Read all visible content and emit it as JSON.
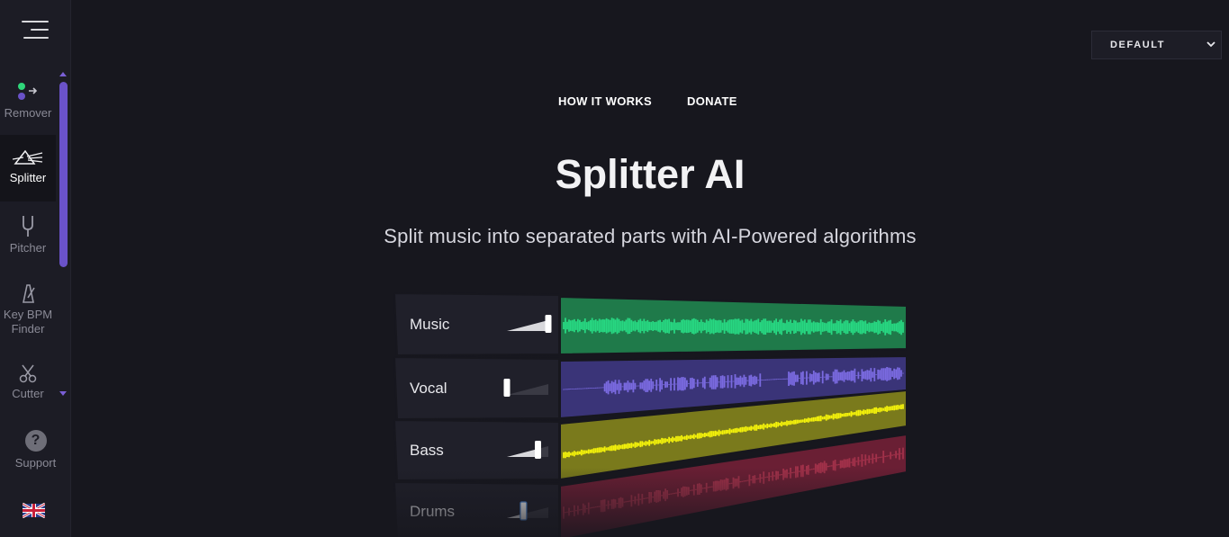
{
  "sidebar": {
    "items": [
      {
        "label": "Remover",
        "icon": "remover-icon"
      },
      {
        "label": "Splitter",
        "icon": "prism-icon",
        "active": true
      },
      {
        "label": "Pitcher",
        "icon": "tuning-fork-icon"
      },
      {
        "label": "Key BPM\nFinder",
        "icon": "metronome-icon"
      },
      {
        "label": "Cutter",
        "icon": "scissors-icon"
      }
    ],
    "support_label": "Support",
    "language_icon": "uk-flag-icon"
  },
  "selector": {
    "value": "DEFAULT"
  },
  "topnav": {
    "how_it_works": "HOW IT WORKS",
    "donate": "DONATE"
  },
  "hero": {
    "title": "Splitter AI",
    "subtitle": "Split music into separated parts with AI-Powered algorithms"
  },
  "tracks": [
    {
      "label": "Music",
      "color": "#27d882",
      "bg": "#1f7a4a",
      "level": 1.0
    },
    {
      "label": "Vocal",
      "color": "#7a6ae0",
      "bg": "#3a3478",
      "level": 0.0
    },
    {
      "label": "Bass",
      "color": "#f4f20a",
      "bg": "#7a7a1c",
      "level": 0.75
    },
    {
      "label": "Drums",
      "color": "#d0405c",
      "bg": "#6a1f34",
      "level": 0.4
    }
  ],
  "colors": {
    "accent": "#6a52c9",
    "background": "#17171e",
    "sidebar": "#1c1c25"
  }
}
